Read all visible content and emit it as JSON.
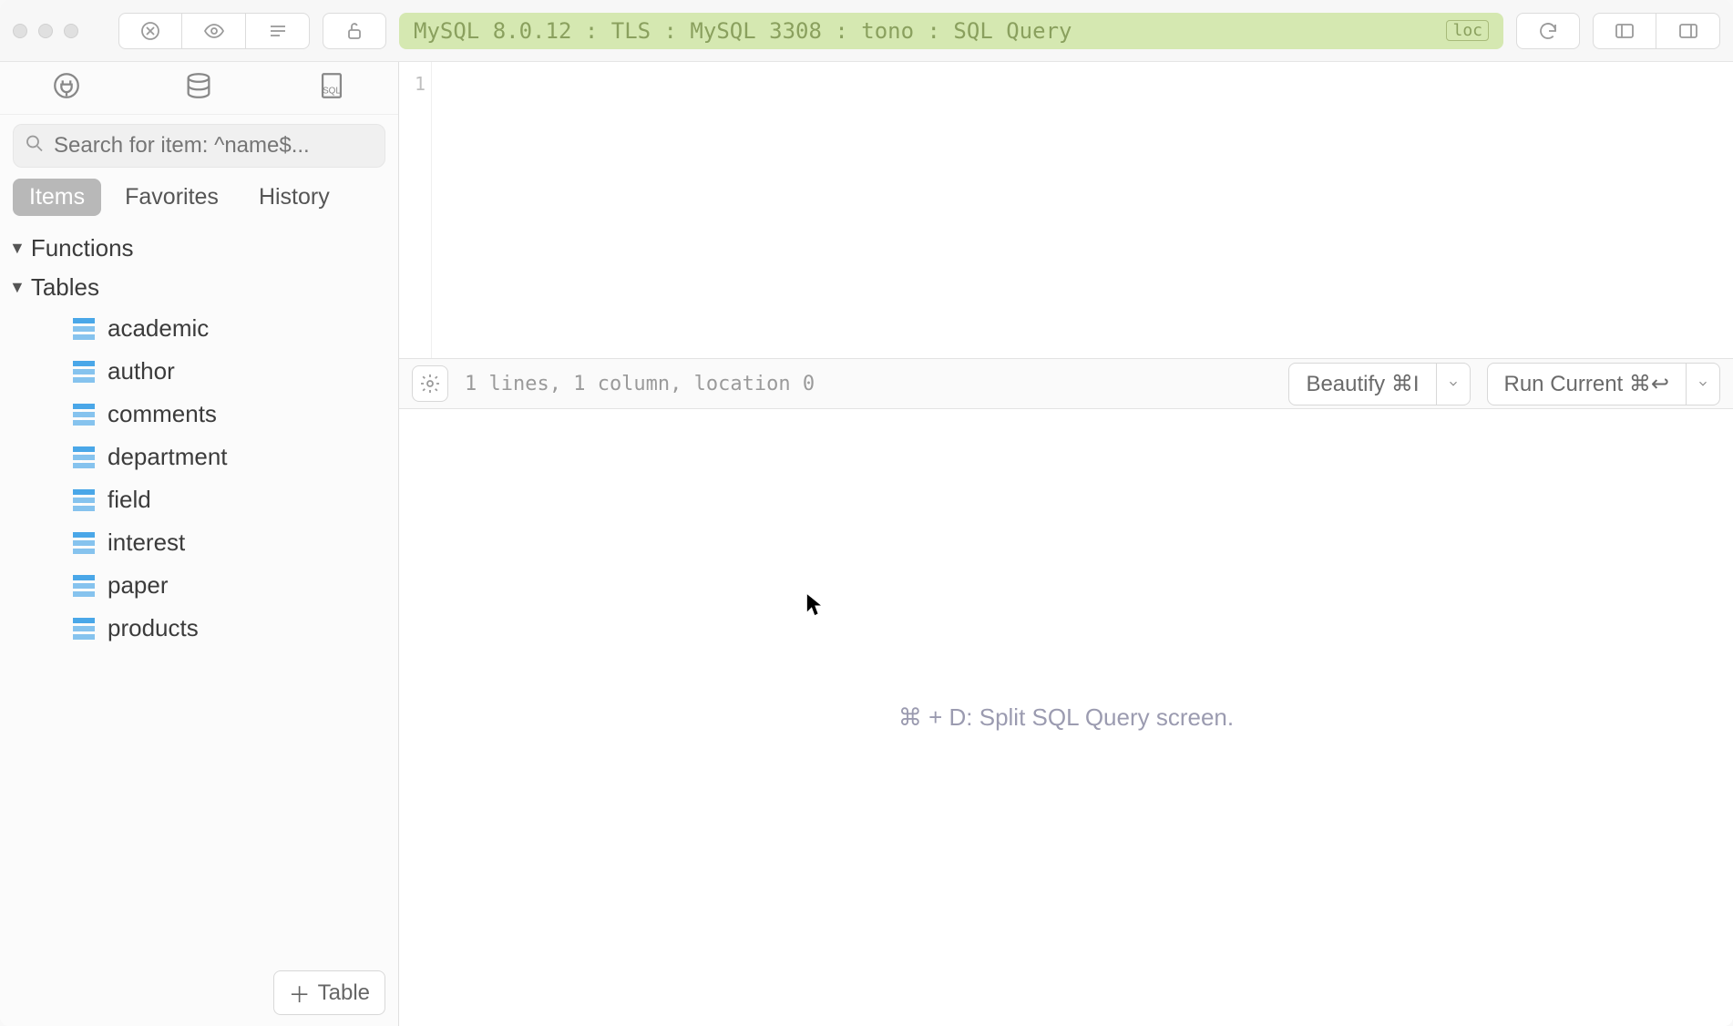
{
  "connection_title": "MySQL 8.0.12 : TLS : MySQL 3308 : tono : SQL Query",
  "loc_badge": "loc",
  "search": {
    "placeholder": "Search for item: ^name$..."
  },
  "section_tabs": {
    "items": "Items",
    "favorites": "Favorites",
    "history": "History"
  },
  "tree": {
    "functions_label": "Functions",
    "tables_label": "Tables",
    "tables": [
      "academic",
      "author",
      "comments",
      "department",
      "field",
      "interest",
      "paper",
      "products"
    ]
  },
  "add_table_label": "Table",
  "editor": {
    "gutter_line": "1"
  },
  "status": "1 lines, 1 column, location 0",
  "beautify_label": "Beautify ⌘I",
  "run_label": "Run Current ⌘↩",
  "hint": "⌘ + D: Split SQL Query screen."
}
